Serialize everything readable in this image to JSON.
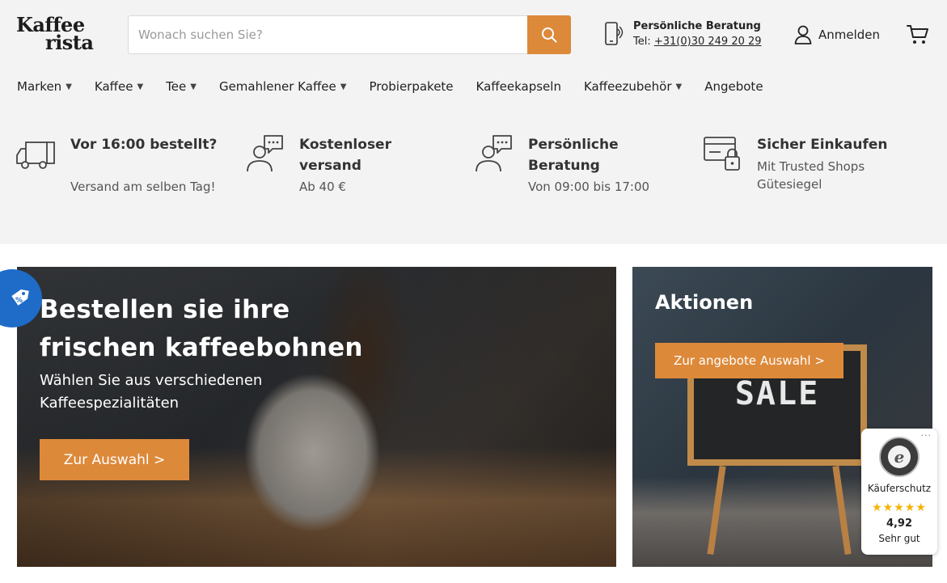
{
  "header": {
    "logo": {
      "line1": "Kaffee",
      "line2": "rista"
    },
    "search": {
      "placeholder": "Wonach suchen Sie?",
      "value": ""
    },
    "advice": {
      "title": "Persönliche Beratung",
      "phone_prefix": "Tel: ",
      "phone": "+31(0)30 249 20 29"
    },
    "login_label": "Anmelden"
  },
  "nav": {
    "items": [
      {
        "label": "Marken",
        "dropdown": true
      },
      {
        "label": "Kaffee",
        "dropdown": true
      },
      {
        "label": "Tee",
        "dropdown": true
      },
      {
        "label": "Gemahlener Kaffee",
        "dropdown": true
      },
      {
        "label": "Probierpakete",
        "dropdown": false
      },
      {
        "label": "Kaffeekapseln",
        "dropdown": false
      },
      {
        "label": "Kaffeezubehör",
        "dropdown": true
      },
      {
        "label": "Angebote",
        "dropdown": false
      }
    ]
  },
  "features": [
    {
      "icon": "truck-icon",
      "title": "Vor 16:00 bestellt?",
      "subtitle": "Versand am selben Tag!"
    },
    {
      "icon": "support-chat-icon",
      "title": "Kostenloser versand",
      "subtitle": "Ab 40 €"
    },
    {
      "icon": "support-chat-icon",
      "title": "Persönliche Beratung",
      "subtitle": "Von 09:00 bis 17:00"
    },
    {
      "icon": "secure-card-icon",
      "title": "Sicher Einkaufen",
      "subtitle": "Mit Trusted Shops Gütesiegel"
    }
  ],
  "hero": {
    "title": "Bestellen sie ihre frischen kaffeebohnen",
    "subtitle": "Wählen Sie aus verschiedenen Kaffeespezialitäten",
    "cta": "Zur Auswahl >"
  },
  "promo": {
    "title": "Aktionen",
    "cta": "Zur angebote Auswahl >",
    "board_text": "SALE"
  },
  "trusted_shops": {
    "label": "Käuferschutz",
    "stars": "★★★★★",
    "score": "4,92",
    "grade": "Sehr gut"
  },
  "colors": {
    "accent": "#dd893a",
    "topbar_bg": "#f3f3f3",
    "discount_badge": "#1e6cc8",
    "star": "#f5b300"
  }
}
